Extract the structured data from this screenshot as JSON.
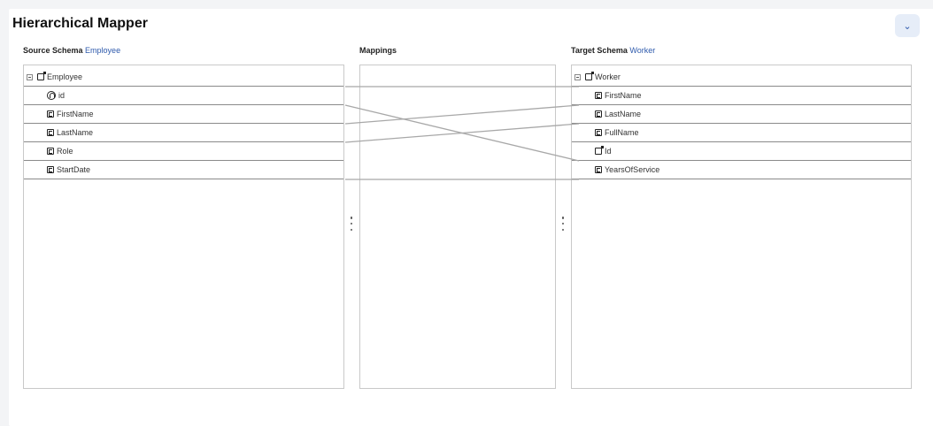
{
  "title": "Hierarchical Mapper",
  "collapse_icon": "chevron-down-icon",
  "source": {
    "label": "Source Schema",
    "schema": "Employee",
    "root": "Employee",
    "fields": [
      "id",
      "FirstName",
      "LastName",
      "Role",
      "StartDate"
    ]
  },
  "mappings": {
    "label": "Mappings"
  },
  "target": {
    "label": "Target Schema",
    "schema": "Worker",
    "root": "Worker",
    "fields": [
      "FirstName",
      "LastName",
      "FullName",
      "Id",
      "YearsOfService"
    ]
  },
  "links": [
    {
      "from": "Employee",
      "to": "Worker"
    },
    {
      "from": "id",
      "to": "Id"
    },
    {
      "from": "FirstName",
      "to": "FirstName"
    },
    {
      "from": "LastName",
      "to": "LastName"
    },
    {
      "from": "StartDate",
      "to": "YearsOfService"
    }
  ],
  "colors": {
    "accent": "#2e5aac",
    "line": "#a8a8a8"
  }
}
